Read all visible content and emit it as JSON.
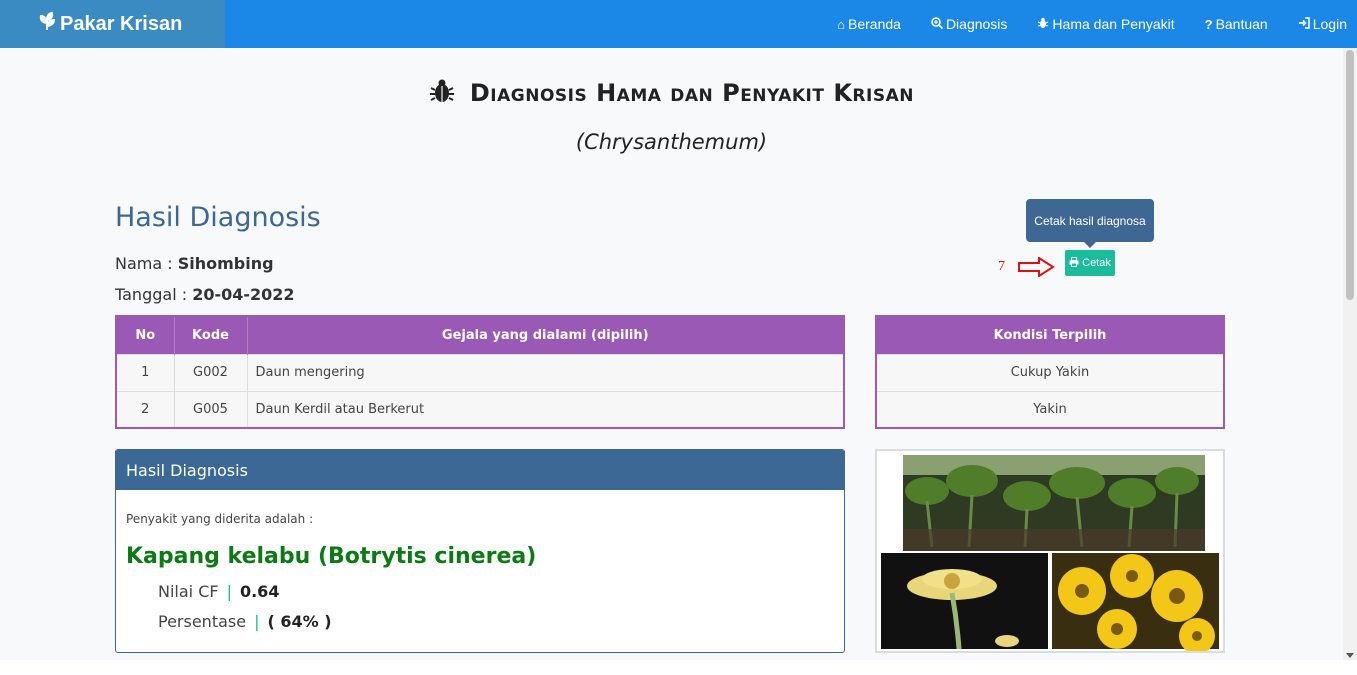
{
  "navbar": {
    "brand": "Pakar Krisan",
    "items": [
      {
        "label": "Beranda",
        "icon": "home-icon"
      },
      {
        "label": "Diagnosis",
        "icon": "search-plus-icon"
      },
      {
        "label": "Hama dan Penyakit",
        "icon": "bug-icon"
      },
      {
        "label": "Bantuan",
        "icon": "question-icon"
      },
      {
        "label": "Login",
        "icon": "sign-in-icon"
      }
    ]
  },
  "page": {
    "title": "Diagnosis Hama dan Penyakit Krisan",
    "subtitle": "(Chrysanthemum)"
  },
  "result": {
    "heading": "Hasil Diagnosis",
    "nama_label": "Nama : ",
    "nama_value": "Sihombing",
    "tanggal_label": "Tanggal : ",
    "tanggal_value": "20-04-2022"
  },
  "print": {
    "tooltip": "Cetak hasil diagnosa",
    "button_label": "Cetak",
    "step_number": "7"
  },
  "gejala_table": {
    "headers": [
      "No",
      "Kode",
      "Gejala yang dialami (dipilih)"
    ],
    "rows": [
      {
        "no": "1",
        "kode": "G002",
        "gejala": "Daun mengering"
      },
      {
        "no": "2",
        "kode": "G005",
        "gejala": "Daun Kerdil atau Berkerut"
      }
    ]
  },
  "kondisi_table": {
    "header": "Kondisi Terpilih",
    "rows": [
      "Cukup Yakin",
      "Yakin"
    ]
  },
  "diagnosis_panel": {
    "title": "Hasil Diagnosis",
    "label": "Penyakit yang diderita adalah :",
    "disease": "Kapang kelabu (Botrytis cinerea)",
    "cf_label": "Nilai CF",
    "cf_value": "0.64",
    "persen_label": "Persentase",
    "persen_value": "( 64% )"
  },
  "colors": {
    "navbar": "#1b87e7",
    "brand_bg": "#3b8bc3",
    "table_header": "#9b59b6",
    "panel_header": "#3b6894",
    "print_button": "#1abc9c",
    "disease_text": "#0c7a14"
  }
}
